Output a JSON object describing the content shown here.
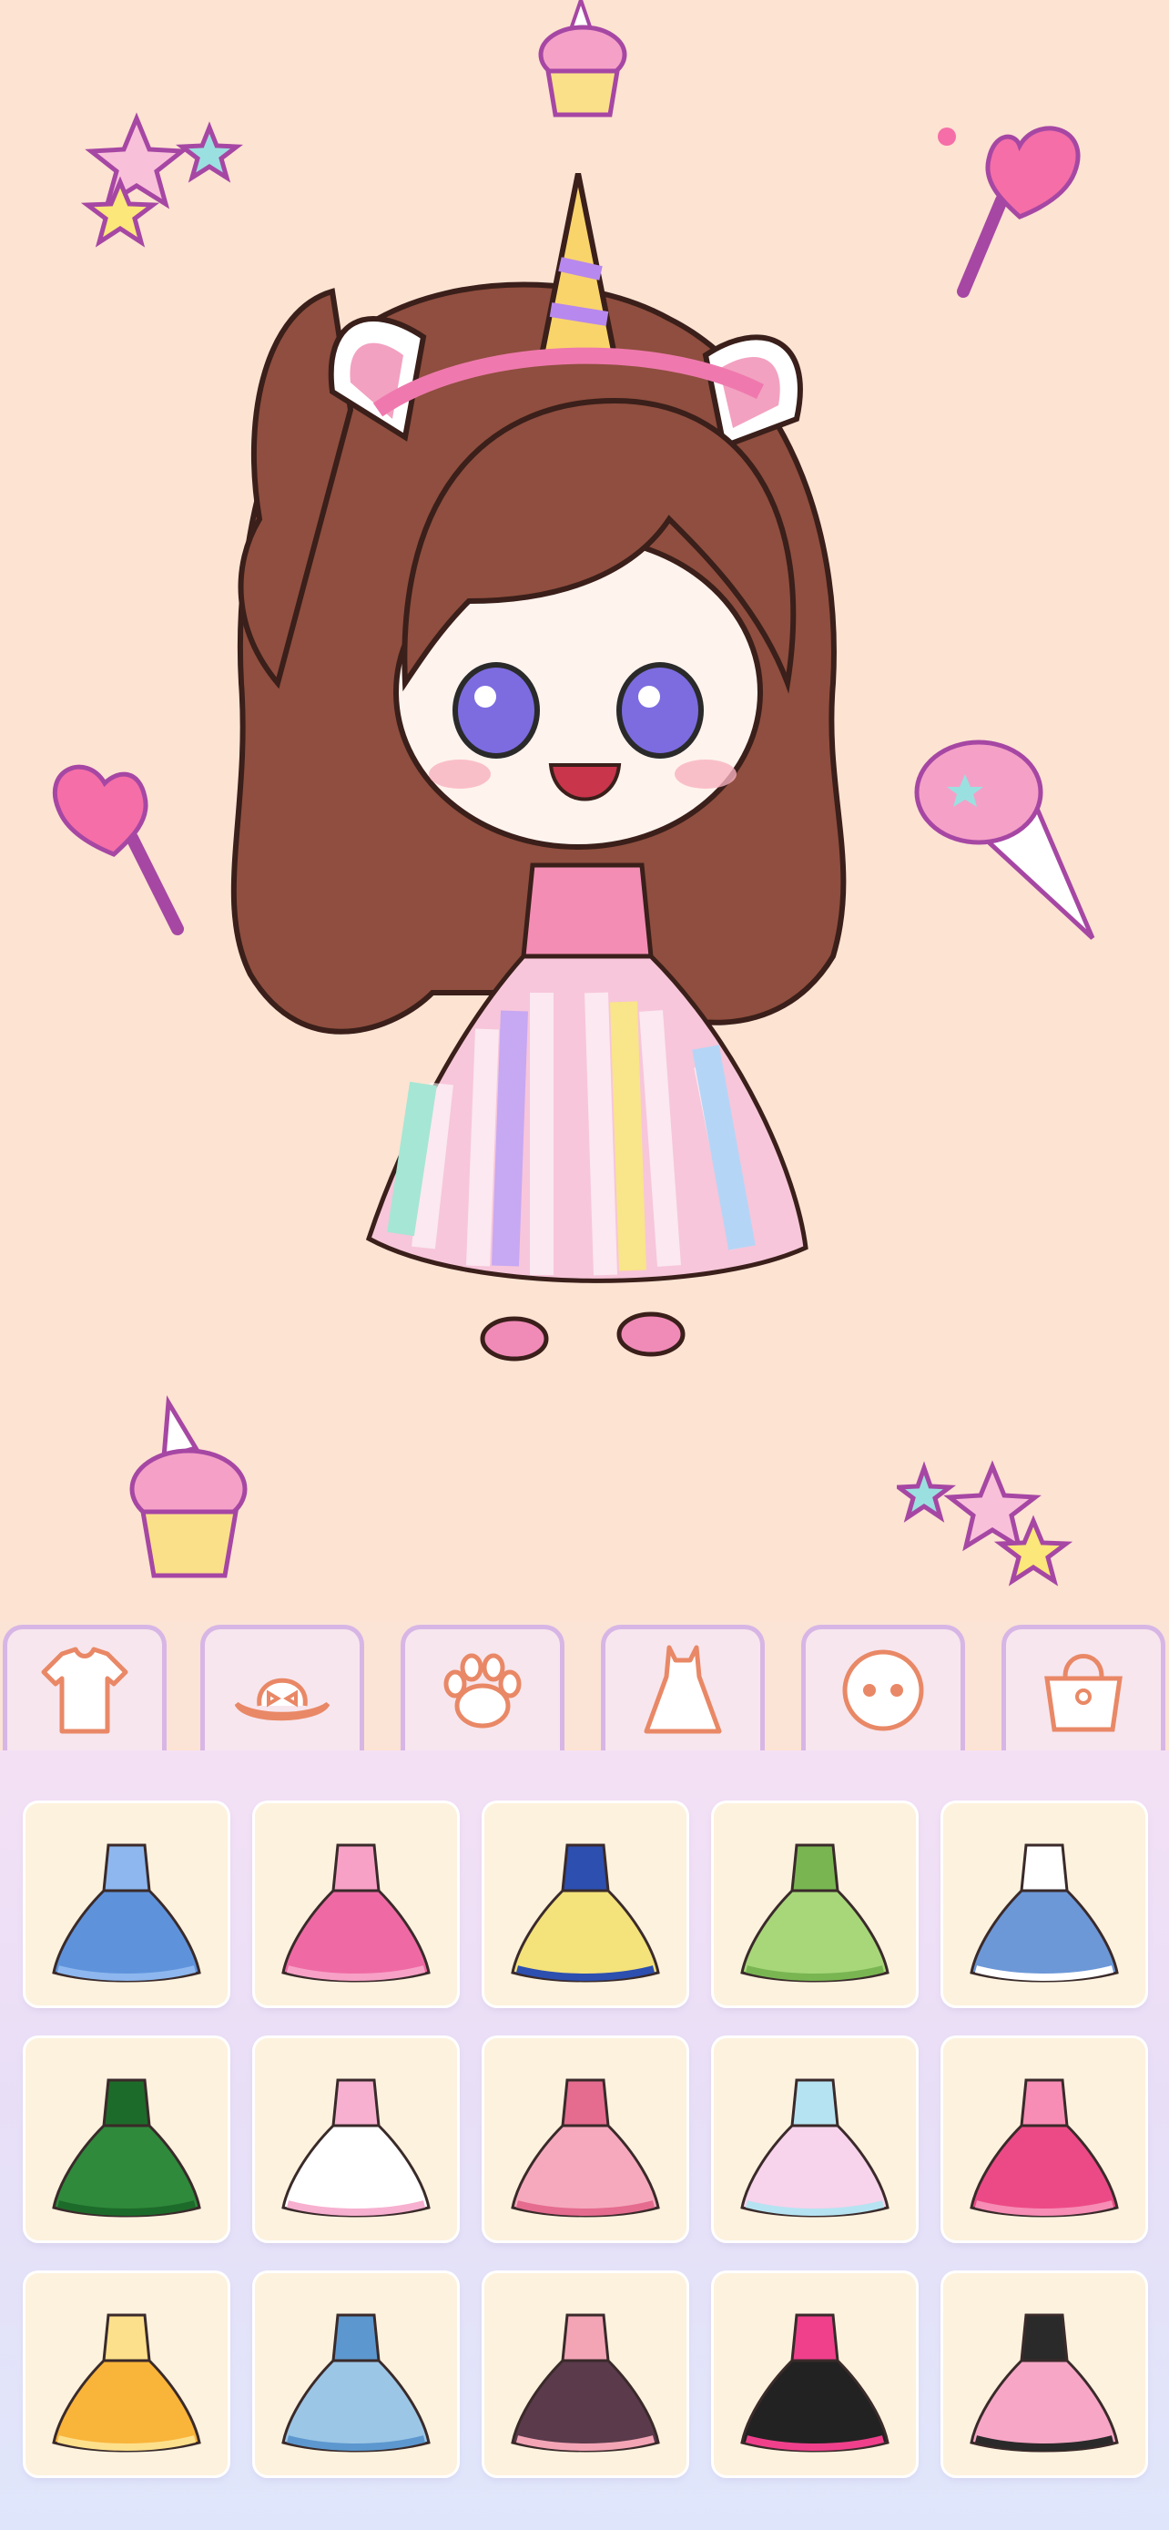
{
  "app": {
    "screen": "dress-up-editor"
  },
  "colors": {
    "background": "#fde3d2",
    "tab_border": "#d7b6e6",
    "icon_line": "#e98866",
    "card_bg": "#fdf2de"
  },
  "stickers": [
    "stars-icon",
    "cupcake-icon",
    "lollipop-icon",
    "ice-cream-icon"
  ],
  "category_tabs": [
    {
      "name": "tab-tops",
      "icon": "tshirt-icon"
    },
    {
      "name": "tab-hats",
      "icon": "sun-hat-icon"
    },
    {
      "name": "tab-pets",
      "icon": "paw-icon"
    },
    {
      "name": "tab-dresses",
      "icon": "dress-icon",
      "selected": true
    },
    {
      "name": "tab-faces",
      "icon": "face-icon"
    },
    {
      "name": "tab-bags",
      "icon": "handbag-icon"
    }
  ],
  "outfits": [
    {
      "name": "blue-ball-gown",
      "color": "#5e93dc",
      "accent": "#8db7ee"
    },
    {
      "name": "pink-shark-overalls",
      "color": "#ef6aa4",
      "accent": "#f7a1c6"
    },
    {
      "name": "snow-white-dress",
      "color": "#f4e27a",
      "accent": "#2c4fb0"
    },
    {
      "name": "green-leaf-dress",
      "color": "#a8d77a",
      "accent": "#79b652"
    },
    {
      "name": "blue-sailor-dress",
      "color": "#6c98d8",
      "accent": "#ffffff"
    },
    {
      "name": "green-dino-costume",
      "color": "#2f8a3c",
      "accent": "#1d6b2a"
    },
    {
      "name": "rainbow-frill-dress",
      "color": "#ffffff",
      "accent": "#f7b0d0"
    },
    {
      "name": "pink-princess-dress",
      "color": "#f6a9bd",
      "accent": "#e56c8f"
    },
    {
      "name": "rainbow-tulle-dress",
      "color": "#f7d3ec",
      "accent": "#b6e3f1"
    },
    {
      "name": "pink-kitty-dress",
      "color": "#ec4a86",
      "accent": "#f78cb4"
    },
    {
      "name": "orange-sunny-dress",
      "color": "#f9b43a",
      "accent": "#fde08c"
    },
    {
      "name": "light-blue-bow-dress",
      "color": "#9cc6e6",
      "accent": "#5c98cf"
    },
    {
      "name": "maid-checkered-dress",
      "color": "#5a3a4b",
      "accent": "#f3a5b6"
    },
    {
      "name": "black-pink-bow-dress",
      "color": "#222222",
      "accent": "#f0408c"
    },
    {
      "name": "pink-ruffle-dress",
      "color": "#f7a6c6",
      "accent": "#2a2a2a"
    }
  ]
}
